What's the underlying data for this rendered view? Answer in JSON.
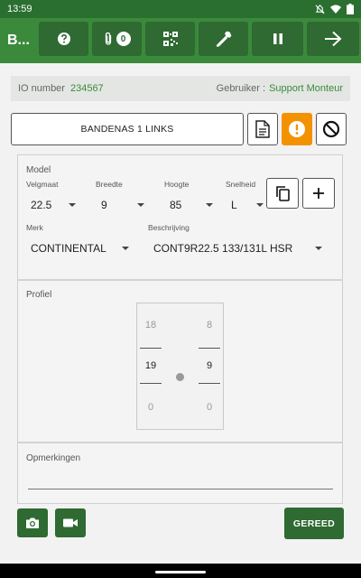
{
  "status": {
    "time": "13:59"
  },
  "appbar": {
    "title": "B...",
    "attachment_count": "0"
  },
  "info": {
    "io_label": "IO number",
    "io_value": "234567",
    "user_label": "Gebruiker :",
    "user_value": "Support Monteur"
  },
  "tire": {
    "title": "BANDENAS 1 LINKS"
  },
  "model": {
    "section_label": "Model",
    "fields": [
      {
        "label": "Velgmaat",
        "value": "22.5"
      },
      {
        "label": "Breedte",
        "value": "9"
      },
      {
        "label": "Hoogte",
        "value": "85"
      },
      {
        "label": "Snelheid",
        "value": "L"
      }
    ],
    "brand_label": "Merk",
    "brand_value": "CONTINENTAL",
    "desc_label": "Beschrijving",
    "desc_value": "CONT9R22.5 133/131L HSR"
  },
  "profile": {
    "section_label": "Profiel",
    "left": {
      "prev": "18",
      "current": "19",
      "next": "0"
    },
    "right": {
      "prev": "8",
      "current": "9",
      "next": "0"
    }
  },
  "remarks": {
    "label": "Opmerkingen",
    "value": ""
  },
  "actions": {
    "done_label": "GEREED"
  },
  "colors": {
    "primary": "#3b8a3c",
    "dark": "#2e6a31",
    "warning": "#f39200"
  }
}
